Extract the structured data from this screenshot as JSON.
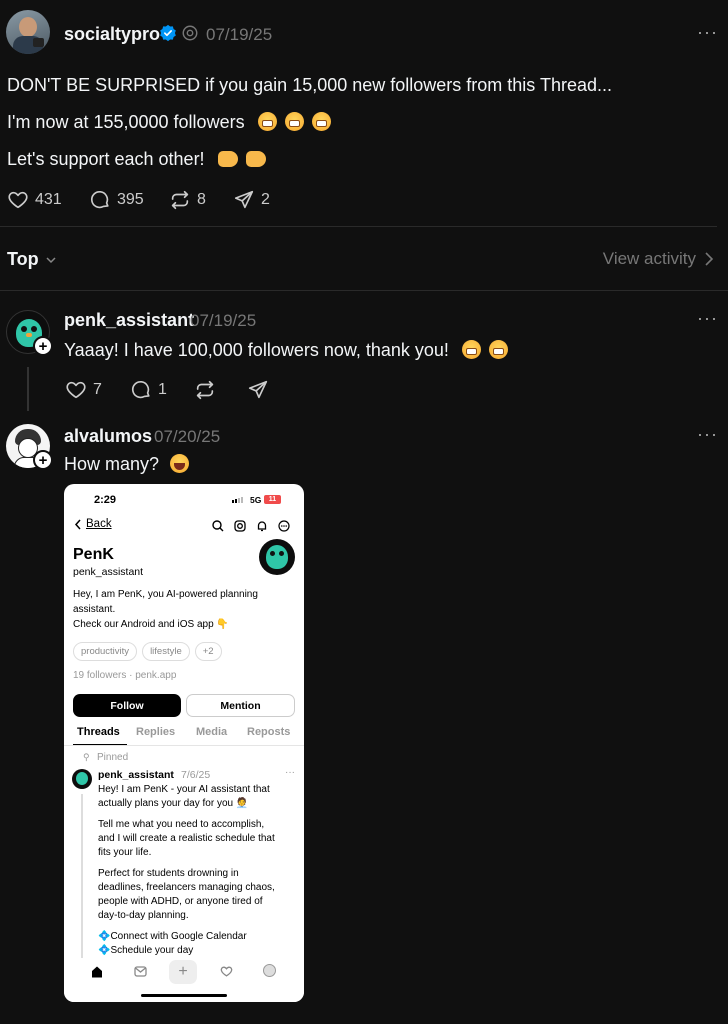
{
  "post": {
    "username": "socialtypro",
    "date": "07/19/25",
    "more": "···",
    "lines": [
      "DON'T BE SURPRISED if you gain 15,000 new followers from this Thread...",
      "I'm now at 155,0000 followers",
      "Let's support each other!"
    ],
    "stats": {
      "likes": "431",
      "replies": "395",
      "reposts": "8",
      "shares": "2"
    }
  },
  "filter": {
    "label": "Top",
    "view_activity": "View activity"
  },
  "replies": [
    {
      "username": "penk_assistant",
      "date": "07/19/25",
      "text": "Yaaay! I have 100,000 followers now, thank you!",
      "likes": "7",
      "replies": "1"
    },
    {
      "username": "alvalumos",
      "date": "07/20/25",
      "text": "How many?"
    }
  ],
  "embedded": {
    "status_time": "2:29",
    "status_net": "5G",
    "status_battery": "11",
    "back": "Back",
    "profile_name": "PenK",
    "profile_handle": "penk_assistant",
    "bio_1": "Hey, I am PenK, you AI-powered planning",
    "bio_2": "assistant.",
    "bio_3": "Check our Android and iOS app 👇",
    "chips": [
      "productivity",
      "lifestyle",
      "+2"
    ],
    "followers_line": "19 followers · penk.app",
    "follow": "Follow",
    "mention": "Mention",
    "tabs": [
      "Threads",
      "Replies",
      "Media",
      "Reposts"
    ],
    "pinned": "Pinned",
    "pinned_user": "penk_assistant",
    "pinned_date": "7/6/25",
    "pinned_more": "···",
    "pinned_lines": [
      "Hey! I am PenK - your AI assistant that",
      "actually plans your day for you 🧑‍💼"
    ],
    "para2": [
      "Tell me what you need to accomplish,",
      "and I will create a realistic schedule that",
      "fits your life."
    ],
    "para3": [
      "Perfect for students drowning in",
      "deadlines, freelancers managing chaos,",
      "people with ADHD, or anyone tired of",
      "day-to-day planning."
    ],
    "bullets": [
      "💠Connect with Google Calendar",
      "💠Schedule your day"
    ]
  },
  "colors": {
    "background": "#101010",
    "text": "#f3f5f7",
    "muted": "#777777",
    "verified": "#0095f6"
  }
}
